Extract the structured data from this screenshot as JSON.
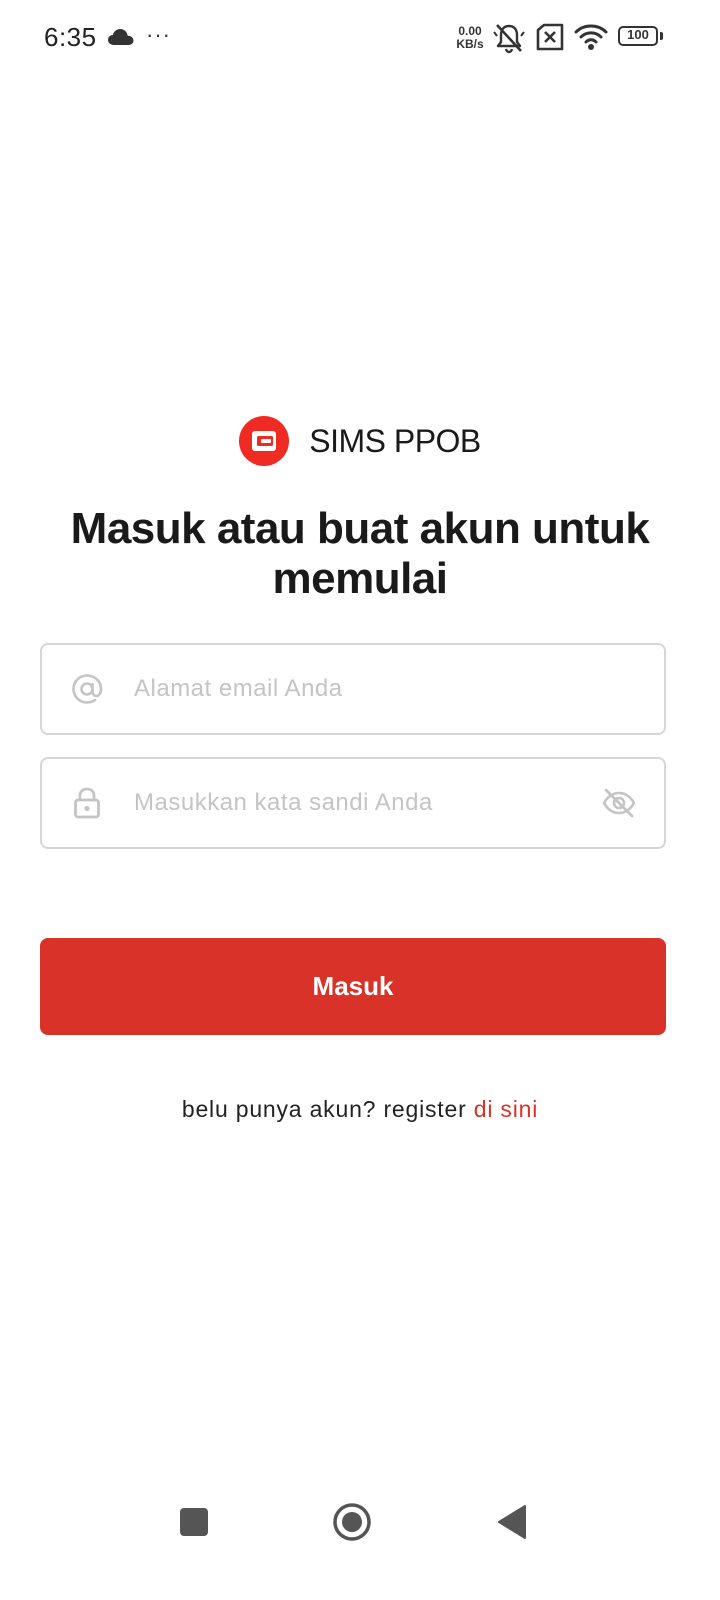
{
  "status_bar": {
    "time": "6:35",
    "more_indicator": "···",
    "net_speed_value": "0.00",
    "net_speed_unit": "KB/s",
    "battery_level": "100",
    "icons": [
      "cloud-icon",
      "silent-bell-icon",
      "no-sim-icon",
      "wifi-icon",
      "battery-icon"
    ]
  },
  "brand": {
    "name": "SIMS PPOB",
    "logo_color": "#ef2b24"
  },
  "heading": "Masuk atau buat akun untuk memulai",
  "form": {
    "email_placeholder": "Alamat email Anda",
    "email_value": "",
    "password_placeholder": "Masukkan kata sandi Anda",
    "password_value": "",
    "submit_label": "Masuk"
  },
  "register": {
    "prompt": "belu punya akun? register ",
    "link_label": "di sini"
  },
  "colors": {
    "accent": "#d93228",
    "border": "#d6d6d6",
    "placeholder": "#c4c4c4"
  },
  "nav_bar": {
    "icons": [
      "recent-apps-icon",
      "home-icon",
      "back-icon"
    ]
  }
}
